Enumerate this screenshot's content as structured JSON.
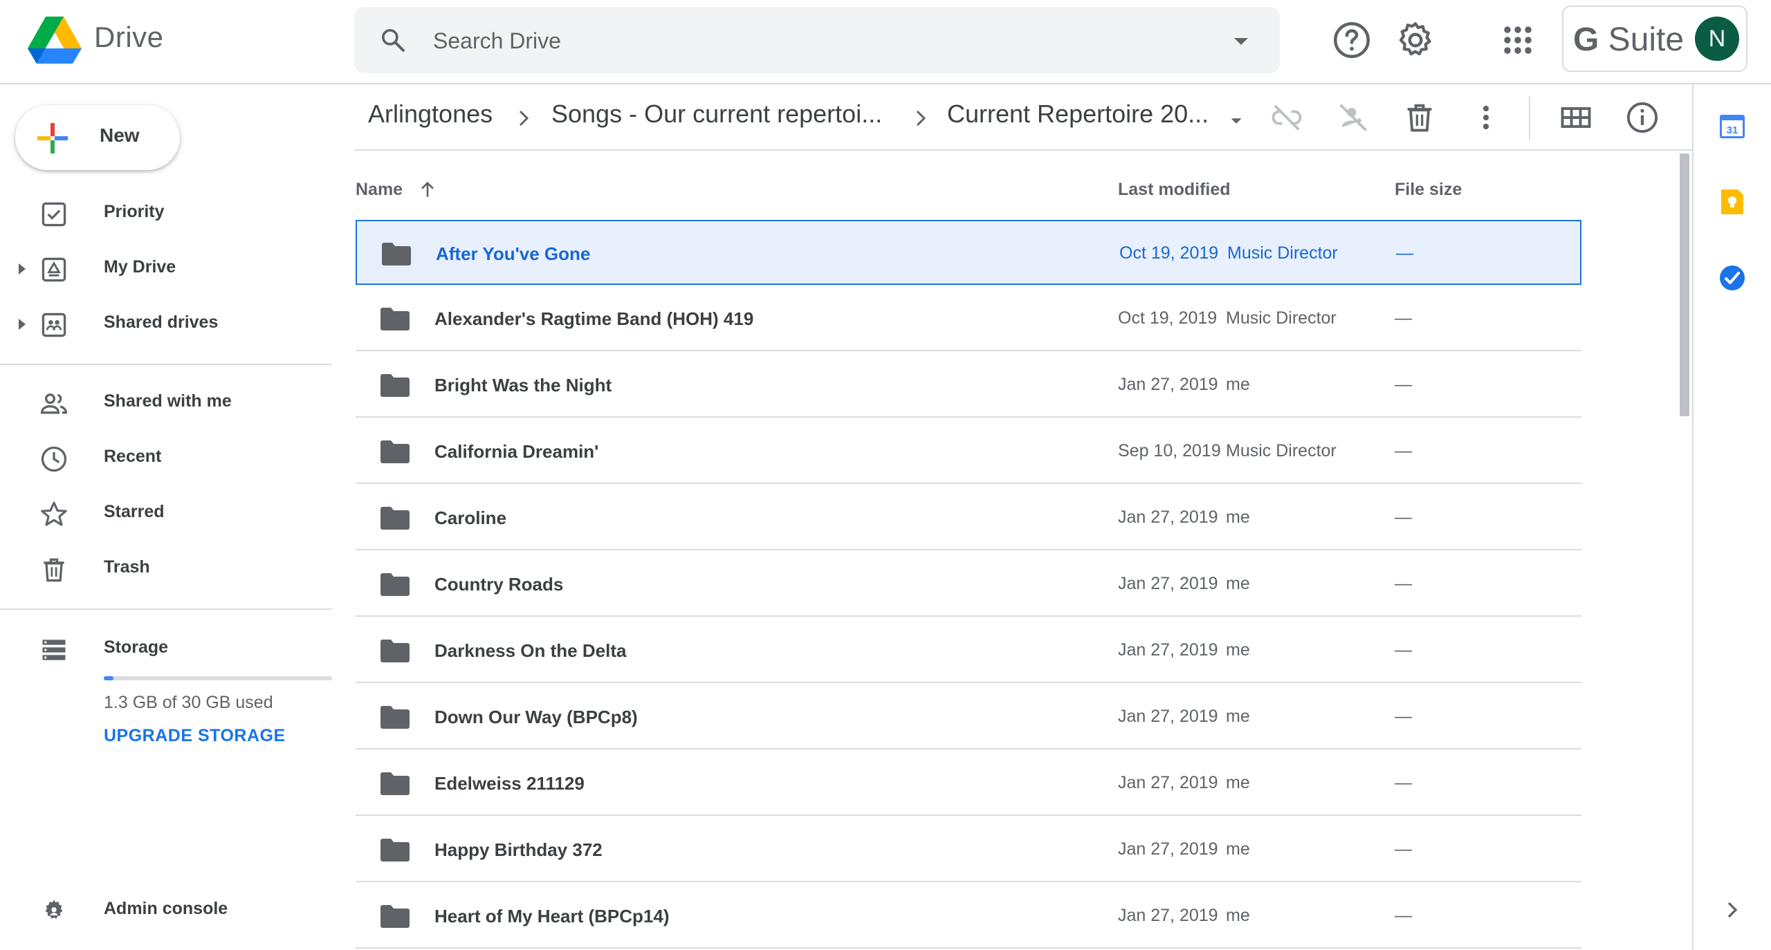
{
  "app": {
    "title": "Drive"
  },
  "search": {
    "placeholder": "Search Drive"
  },
  "header": {
    "gsuite_prefix": "G",
    "gsuite_suffix": " Suite",
    "avatar_initial": "N"
  },
  "sidebar": {
    "new_label": "New",
    "items": [
      {
        "label": "Priority"
      },
      {
        "label": "My Drive"
      },
      {
        "label": "Shared drives"
      },
      {
        "label": "Shared with me"
      },
      {
        "label": "Recent"
      },
      {
        "label": "Starred"
      },
      {
        "label": "Trash"
      },
      {
        "label": "Storage"
      },
      {
        "label": "Admin console"
      }
    ],
    "storage": {
      "used_text": "1.3 GB of 30 GB used",
      "used_fraction": 0.043,
      "upgrade_label": "UPGRADE STORAGE"
    }
  },
  "breadcrumb": [
    "Arlingtones",
    "Songs - Our current repertoi...",
    "Current Repertoire 20..."
  ],
  "file_list": {
    "headers": {
      "name": "Name",
      "last_modified": "Last modified",
      "file_size": "File size"
    },
    "rows": [
      {
        "name": "After You've Gone",
        "date": "Oct 19, 2019",
        "owner": "Music Director",
        "size": "—",
        "selected": true
      },
      {
        "name": "Alexander's Ragtime Band (HOH) 419",
        "date": "Oct 19, 2019",
        "owner": "Music Director",
        "size": "—"
      },
      {
        "name": "Bright Was the Night",
        "date": "Jan 27, 2019",
        "owner": "me",
        "size": "—"
      },
      {
        "name": "California Dreamin'",
        "date": "Sep 10, 2019",
        "owner": "Music Director",
        "size": "—"
      },
      {
        "name": "Caroline",
        "date": "Jan 27, 2019",
        "owner": "me",
        "size": "—"
      },
      {
        "name": "Country Roads",
        "date": "Jan 27, 2019",
        "owner": "me",
        "size": "—"
      },
      {
        "name": "Darkness On the Delta",
        "date": "Jan 27, 2019",
        "owner": "me",
        "size": "—"
      },
      {
        "name": "Down Our Way (BPCp8)",
        "date": "Jan 27, 2019",
        "owner": "me",
        "size": "—"
      },
      {
        "name": "Edelweiss 211129",
        "date": "Jan 27, 2019",
        "owner": "me",
        "size": "—"
      },
      {
        "name": "Happy Birthday 372",
        "date": "Jan 27, 2019",
        "owner": "me",
        "size": "—"
      },
      {
        "name": "Heart of My Heart (BPCp14)",
        "date": "Jan 27, 2019",
        "owner": "me",
        "size": "—"
      }
    ]
  },
  "side_panel": {
    "calendar_day": "31"
  },
  "colors": {
    "accent": "#1a73e8",
    "selected_bg": "#e8f0fe",
    "folder": "#5f6368",
    "text": "#3c4043"
  },
  "icons": [
    "search-icon",
    "help-icon",
    "settings-icon",
    "apps-icon",
    "priority-icon",
    "my-drive-icon",
    "shared-drives-icon",
    "shared-with-me-icon",
    "recent-icon",
    "starred-icon",
    "trash-icon",
    "storage-icon",
    "admin-console-icon",
    "link-off-icon",
    "share-off-icon",
    "delete-icon",
    "more-vert-icon",
    "grid-view-icon",
    "info-icon",
    "folder-icon",
    "calendar-icon",
    "keep-icon",
    "tasks-icon",
    "chevron-right-icon"
  ]
}
